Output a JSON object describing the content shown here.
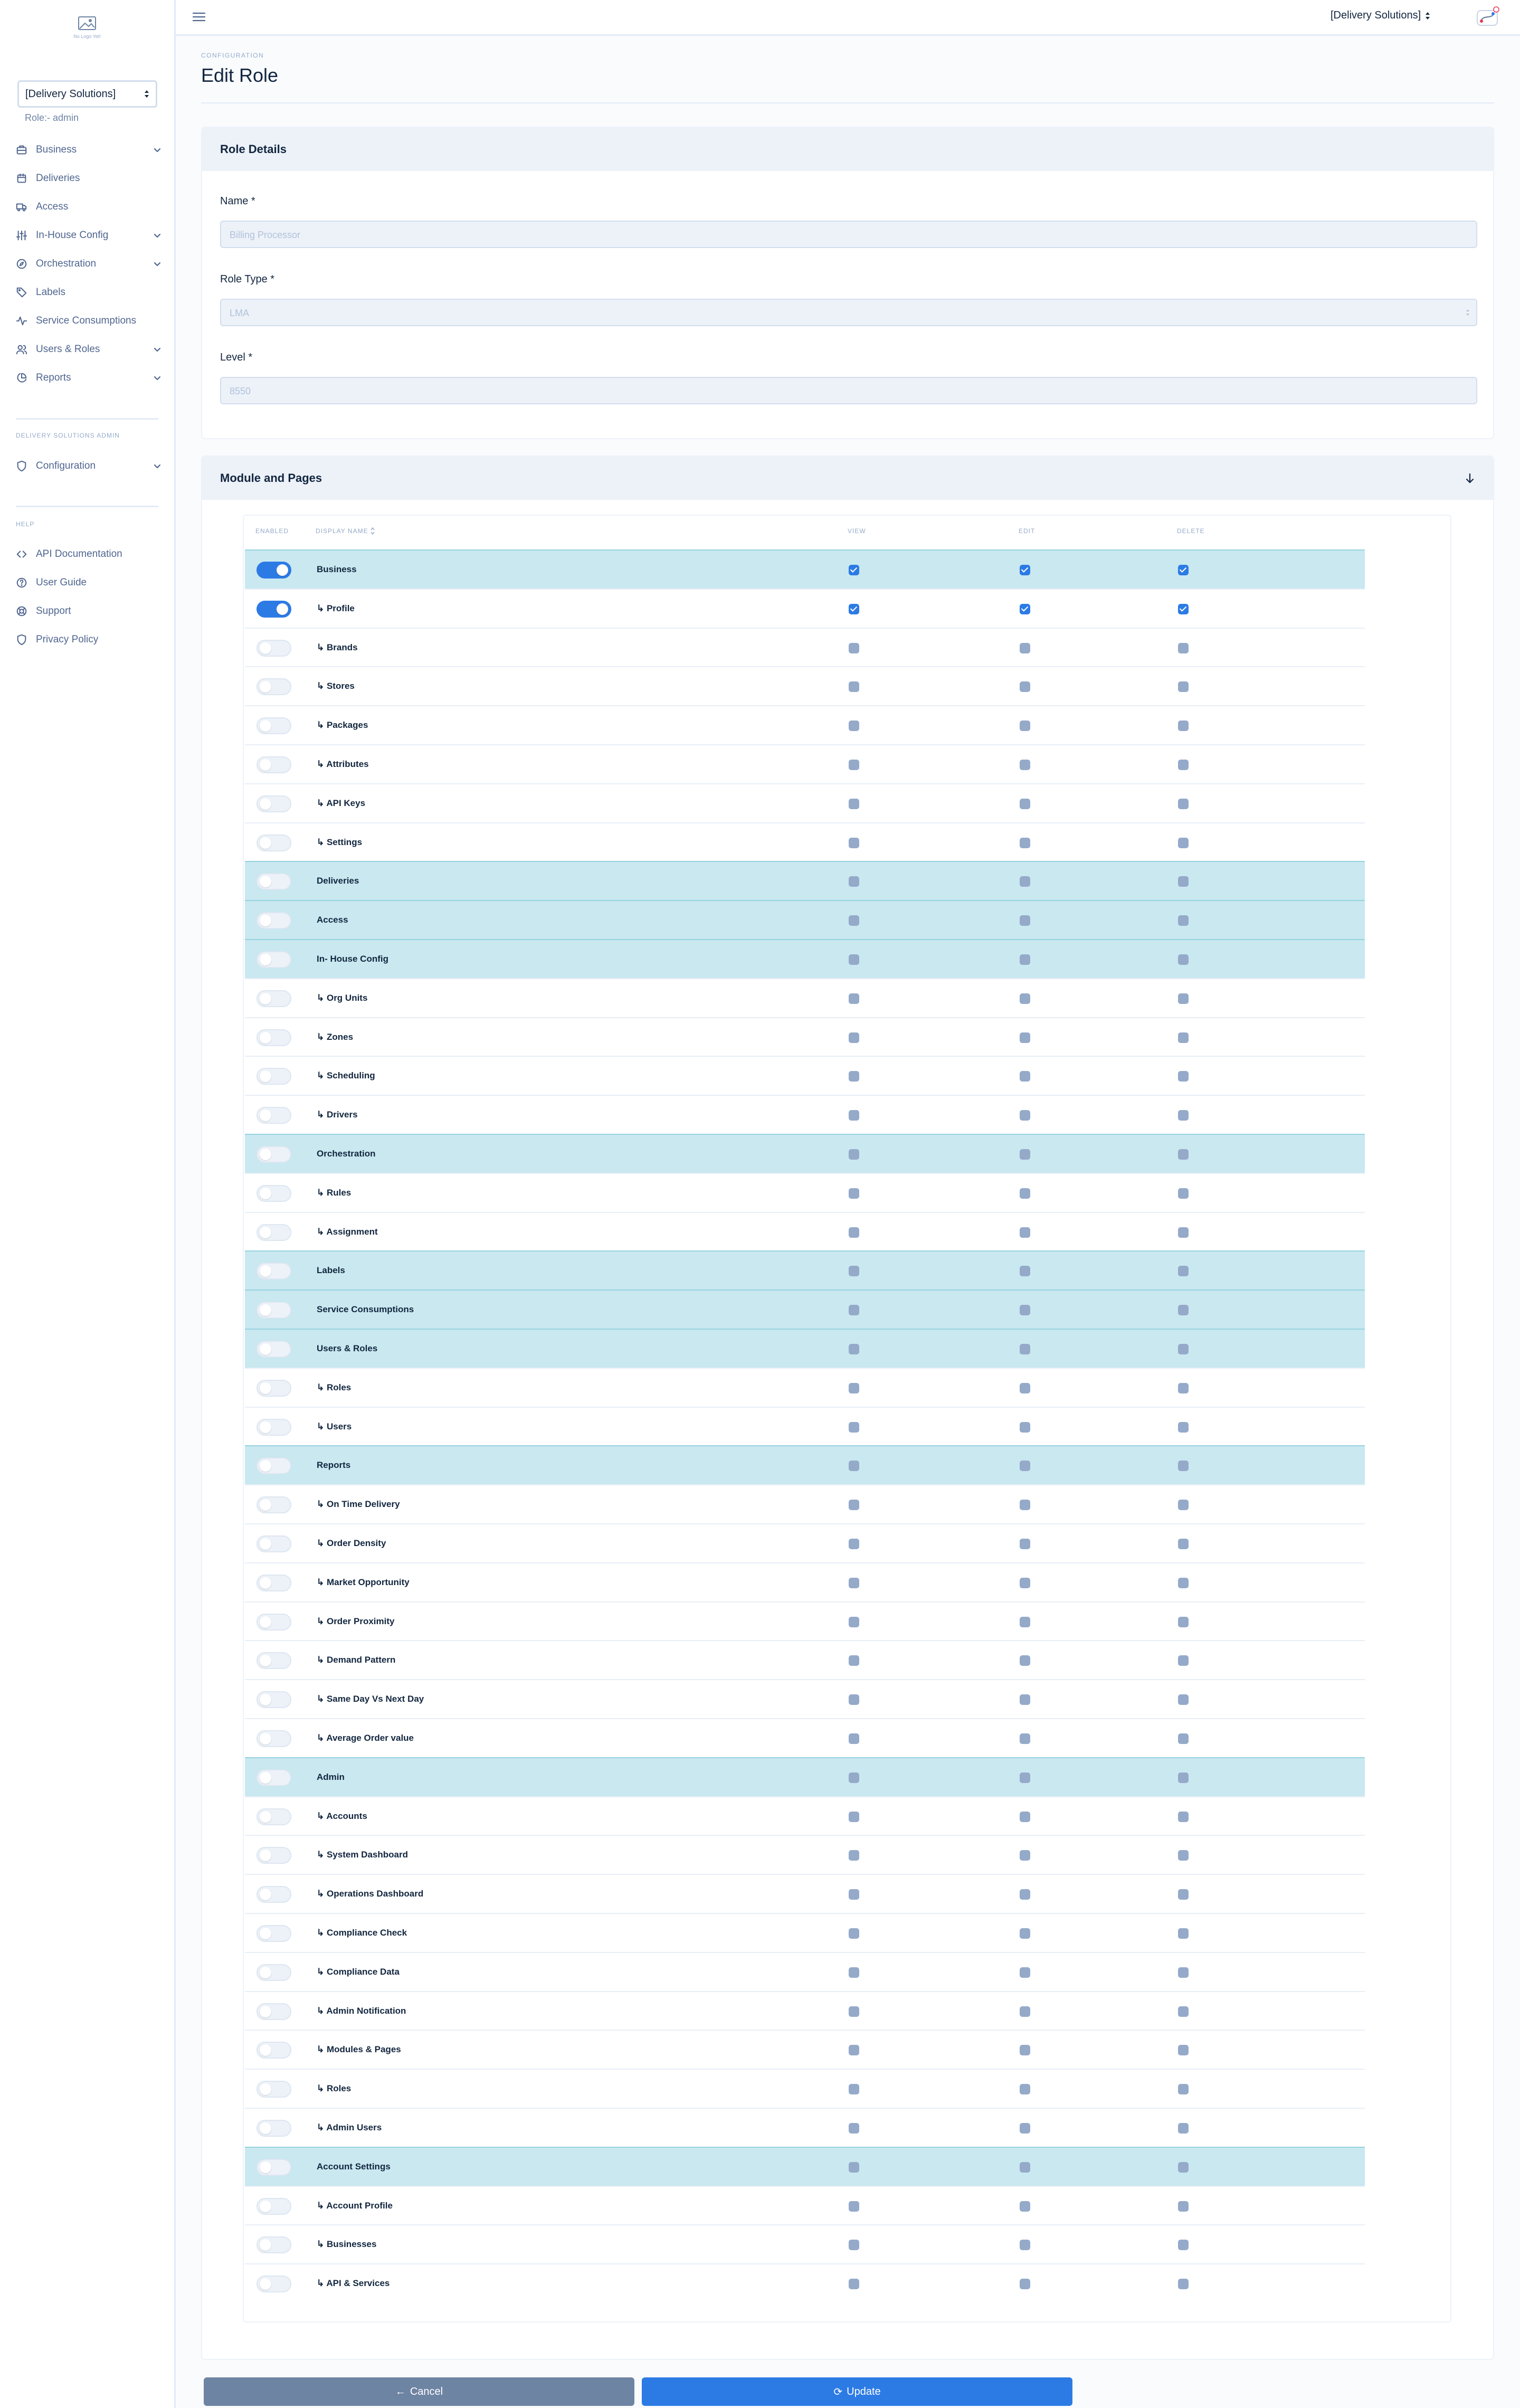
{
  "sidebar": {
    "logo_caption": "No Logo Yet!",
    "company_select": "[Delivery Solutions]",
    "role_label": "Role:- admin",
    "nav": [
      {
        "label": "Business",
        "icon": "briefcase-icon",
        "has_chevron": true
      },
      {
        "label": "Deliveries",
        "icon": "calendar-icon",
        "has_chevron": false
      },
      {
        "label": "Access",
        "icon": "truck-icon",
        "has_chevron": false
      },
      {
        "label": "In-House Config",
        "icon": "sliders-icon",
        "has_chevron": true
      },
      {
        "label": "Orchestration",
        "icon": "compass-icon",
        "has_chevron": true
      },
      {
        "label": "Labels",
        "icon": "tag-icon",
        "has_chevron": false
      },
      {
        "label": "Service Consumptions",
        "icon": "activity-icon",
        "has_chevron": false
      },
      {
        "label": "Users & Roles",
        "icon": "users-icon",
        "has_chevron": true
      },
      {
        "label": "Reports",
        "icon": "pie-chart-icon",
        "has_chevron": true
      }
    ],
    "admin_heading": "DELIVERY SOLUTIONS ADMIN",
    "admin_nav": [
      {
        "label": "Configuration",
        "icon": "shield-icon",
        "has_chevron": true
      }
    ],
    "help_heading": "HELP",
    "help_nav": [
      {
        "label": "API Documentation",
        "icon": "code-icon"
      },
      {
        "label": "User Guide",
        "icon": "help-circle-icon"
      },
      {
        "label": "Support",
        "icon": "life-buoy-icon"
      },
      {
        "label": "Privacy Policy",
        "icon": "shield-icon"
      }
    ]
  },
  "topbar": {
    "company": "[Delivery Solutions]"
  },
  "header": {
    "pretitle": "CONFIGURATION",
    "title": "Edit Role"
  },
  "role_details": {
    "title": "Role Details",
    "name_label": "Name *",
    "name_value": "Billing Processor",
    "role_type_label": "Role Type *",
    "role_type_value": "LMA",
    "level_label": "Level *",
    "level_value": "8550"
  },
  "modules": {
    "title": "Module and Pages",
    "columns": {
      "enabled": "ENABLED",
      "display_name": "DISPLAY NAME",
      "view": "VIEW",
      "edit": "EDIT",
      "delete": "DELETE"
    },
    "rows": [
      {
        "name": "Business",
        "parent": true,
        "enabled": true,
        "view": true,
        "edit": true,
        "delete": true
      },
      {
        "name": "↳ Profile",
        "parent": false,
        "enabled": true,
        "view": true,
        "edit": true,
        "delete": true
      },
      {
        "name": "↳ Brands",
        "parent": false
      },
      {
        "name": "↳ Stores",
        "parent": false
      },
      {
        "name": "↳ Packages",
        "parent": false
      },
      {
        "name": "↳ Attributes",
        "parent": false
      },
      {
        "name": "↳ API Keys",
        "parent": false
      },
      {
        "name": "↳ Settings",
        "parent": false
      },
      {
        "name": "Deliveries",
        "parent": true
      },
      {
        "name": "Access",
        "parent": true
      },
      {
        "name": "In- House Config",
        "parent": true
      },
      {
        "name": "↳ Org Units",
        "parent": false
      },
      {
        "name": "↳ Zones",
        "parent": false
      },
      {
        "name": "↳ Scheduling",
        "parent": false
      },
      {
        "name": "↳ Drivers",
        "parent": false
      },
      {
        "name": "Orchestration",
        "parent": true
      },
      {
        "name": "↳ Rules",
        "parent": false
      },
      {
        "name": "↳ Assignment",
        "parent": false
      },
      {
        "name": "Labels",
        "parent": true
      },
      {
        "name": "Service Consumptions",
        "parent": true
      },
      {
        "name": "Users & Roles",
        "parent": true
      },
      {
        "name": "↳ Roles",
        "parent": false
      },
      {
        "name": "↳ Users",
        "parent": false
      },
      {
        "name": "Reports",
        "parent": true
      },
      {
        "name": "↳ On Time Delivery",
        "parent": false
      },
      {
        "name": "↳ Order Density",
        "parent": false
      },
      {
        "name": "↳ Market Opportunity",
        "parent": false
      },
      {
        "name": "↳ Order Proximity",
        "parent": false
      },
      {
        "name": "↳ Demand Pattern",
        "parent": false
      },
      {
        "name": "↳ Same Day Vs Next Day",
        "parent": false
      },
      {
        "name": "↳ Average Order value",
        "parent": false
      },
      {
        "name": "Admin",
        "parent": true
      },
      {
        "name": "↳ Accounts",
        "parent": false
      },
      {
        "name": "↳ System Dashboard",
        "parent": false
      },
      {
        "name": "↳ Operations Dashboard",
        "parent": false
      },
      {
        "name": "↳ Compliance Check",
        "parent": false
      },
      {
        "name": "↳ Compliance Data",
        "parent": false
      },
      {
        "name": "↳ Admin Notification",
        "parent": false
      },
      {
        "name": "↳ Modules & Pages",
        "parent": false
      },
      {
        "name": "↳ Roles",
        "parent": false
      },
      {
        "name": "↳ Admin Users",
        "parent": false
      },
      {
        "name": "Account Settings",
        "parent": true
      },
      {
        "name": "↳ Account Profile",
        "parent": false
      },
      {
        "name": "↳ Businesses",
        "parent": false
      },
      {
        "name": "↳ API & Services",
        "parent": false
      }
    ]
  },
  "footer": {
    "cancel_label": "Cancel",
    "update_label": "Update"
  },
  "colors": {
    "primary": "#2c7be5",
    "secondary": "#6e84a3",
    "parent_row": "#c9e8f0"
  }
}
